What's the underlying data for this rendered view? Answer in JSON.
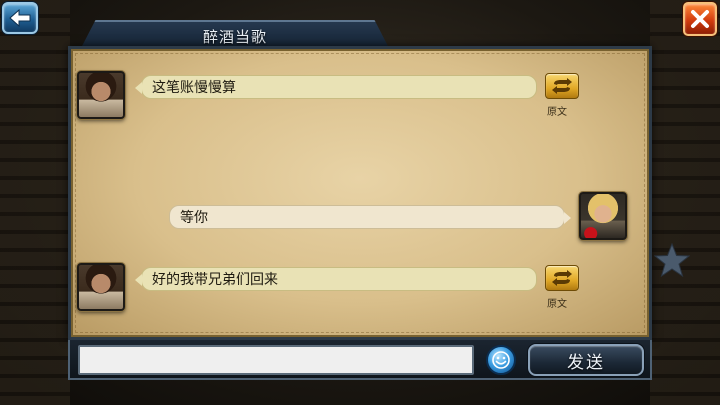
{
  "header": {
    "title": "醉酒当歌",
    "back_icon": "back-arrow-icon",
    "close_icon": "close-x-icon"
  },
  "messages": [
    {
      "side": "left",
      "avatar": "bearded-warrior-avatar",
      "text": "这笔账慢慢算",
      "translate_label": "原文"
    },
    {
      "side": "right",
      "avatar": "blond-knight-avatar",
      "text": "等你"
    },
    {
      "side": "left",
      "avatar": "bearded-warrior-avatar",
      "text": "好的我带兄弟们回来",
      "translate_label": "原文"
    }
  ],
  "input": {
    "value": "",
    "placeholder": ""
  },
  "toolbar": {
    "emoji_icon": "smiley-face-icon",
    "send_label": "发送"
  },
  "colors": {
    "parchment": "#d9bf8b",
    "left_bubble": "#e9e2b5",
    "right_bubble": "#f0e6cf",
    "accent_gold": "#e1a826",
    "close_red": "#d23c0e",
    "back_blue": "#1f5f93"
  }
}
